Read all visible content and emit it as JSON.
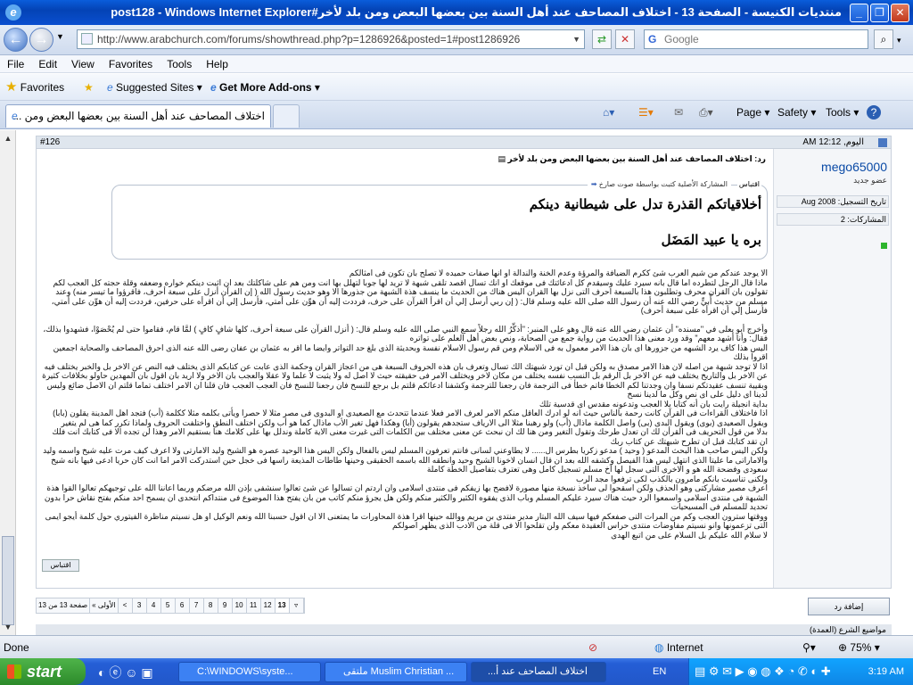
{
  "window": {
    "title": "منتديات الكنيسة - الصفحة 13 - اختلاف المصاحف عند أهل السنة بين بعضها البعض ومن بلد لأخر#post128 - Windows Internet Explorer",
    "minimize": "_",
    "maximize": "❐",
    "close": "✕"
  },
  "address": {
    "url": "http://www.arabchurch.com/forums/showthread.php?p=1286926&posted=1#post1286926",
    "search_placeholder": "Google"
  },
  "menu": [
    "File",
    "Edit",
    "View",
    "Favorites",
    "Tools",
    "Help"
  ],
  "favorites_bar": {
    "favorites": "Favorites",
    "suggested": "Suggested Sites ▾",
    "addons": "Get More Add-ons ▾"
  },
  "tabs": {
    "active": "اختلاف المصاحف عند أهل السنة بين بعضها البعض ومن ..."
  },
  "command_bar": {
    "page": "Page ▾",
    "safety": "Safety ▾",
    "tools": "Tools ▾",
    "help": "?"
  },
  "post": {
    "number": "#126",
    "date": "اليوم, 12:12 AM",
    "reply_title": "رد: اختلاف المصاحف عند أهل السنة بين بعضها البعض ومن بلد لأخر",
    "quote_header": "المشاركة الأصلية كتبت بواسطة صوت صارخ",
    "quote_label": "اقتباس",
    "quote_line1": "أخلاقياتكم القذرة تدل على شيطانية دينكم",
    "quote_line2": "بره يا عبيد المَضَل",
    "paragraphs": [
      "الا يوجد عندكم من شيم العرب شئ ككرم الضيافة والمرؤة وعدم الخنة والندالة او انها صفات حميده لا تصلح بان تكون فى امثالكم",
      "ماذا قال الرجل لتطرده اما قال بانه سيرد عليك وسيقدم كل ادعائتك فى موقعك او انك تسال اقصد تلقى شبهة لا تريد لها جوبا لتهلل بها انت ومن هم على شاكلتك بعد ان اثبت دينكم خواره وضعفه وقلة حجته كل العجب لكم تقولون بان القران محرف وتطلبون هذا بالسبعة احرف التى نزل بها القران اليس هناك من الحديث ما ينسف هذة الشبهة من جذورها الا وهو حديث رسول الله ( إن القرآن أنزل على سبعة أحرف، فاقرؤوا ما تيسر منه) وعند مسلم من حديث أُبيٍّ رضي الله عنه أن رسول الله صلى الله عليه وسلم قال: ( إن ربي أرسل إلي أن اقرأ القرآن على حرف، فرددت إليه أن هوِّن على أمتي، فأرسل إلي أن اقرأه على حرفين، فرددت إليه أن هوِّن على أمتي، فأرسل إلي أن اقرأه على سبعة أحرف)",
      "وأخرج أبو يعلى في \"مسنده\" أن عثمان رضي الله عنه قال وهو على المنبر: \"أذكِّرُ الله رجلاً سمع النبي صلى الله عليه وسلم قال: ( أنزل القرآن على سبعة أحرف، كلها شافٍ كافٍ ) لمَّا قام، فقاموا حتى لم يُحْصَوْا، فشهدوا بذلك، فقال: وأنا أشهد معهم\" وقد ورد معنى هذا الحديث من رواية جمع من الصحابة، ونص بعض أهل العلم على تواتره",
      "اليس هذا كاف يرد الشبهه من جزورها اى بان هذا الامر معمول به فى الاسلام ومن قم رسول الاسلام نفسة وبحديثة الذى بلغ حد التواتر وايضا ما اقر به عثمان بن عفان رضى الله عنه الذى احرق المصاحف والصحابة اجمعين اقروا بذلك",
      "اذا لا توجد شبهة من اصله لان هذا الامر مصدق به ولكن قبل ان تورد شبهتك الك تسال وتعرف بان هذه الحروف السبعة هى من اعجاز القران وحكمة الذى عابت عن كتابكم الذى يختلف فيه النص عن الاخر بل والخبر يختلف فيه عن الاخر بل والتاريخ يختلف فيه عن الاخر بل الرقم بل النسب نفسه يختلف من مكان لاخر ويختلف الامر فى حقيقته حيث لا اصل له ولا يثبت لا علما ولا عقلا والعجب بان الاخر ولا اريد بان اقول بان المهدين حاولو بخلافات كثيرة وبقيية تنسف عقيدتكم نسفا وان وجدتنا لكم الخطا فاتم خطأ فى الترجمة فان رجعنا للترجمة وكشفنا ادعائكم قلتم بل برجع للنسخ فان رجعنا للنسخ فان العجب العجب فان قلنا ان الامر اختلف تماما قلتم ان الاصل ضائع وليس لدينا اى دليل على اى نص وكل ما لدينا نسخ",
      "بداية انجيلة رايت بان أنه كتابا بلا العجب وتدعونه مقدس اى قدسية تلك",
      "اذا فاختلاف القراءات فى القرآن كانت رحمة بالناس حيث انه لو ادرك العاقل منكم الامر لعرف الامر فعلا عندما تتحدث مع الصعيدى او البدوى فى مصر مثلا لا حصرا ويأتى بكلمه مثلا ككلمة (أب) فتجد اهل المدينة يقلون (بابا) ويقول الصعيدى (بوى) ويقول البدى (بى) واصل الكلمة ماذال (أب) ولو رهبنا مثلا الى الارياف ستجدهم يقولون (أبا) وهكذا فهل تغير الأب ماذال كما هو أب ولكن اختلف النطق واختلفت الحروف ولماذا تكرر كما هى لم يتغير",
      "بدلا من قول التحريف فى القرأن لك ان تعدل طرحك وتقول التغير ومن هنا لك ان نبحث عن معنى مختلف بين الكلمات التى غيرت معنى الاية كاملة وندلل بها على كلامك هنا بستقيم الامر وهذا لن تجده الا فى كتابك انت فلك ان تقد كتابك قبل ان تطرح شبهتك عن كتاب ربك",
      "ولكن اليس صاحب هذا البحث المدعو ( وحيد ) مدعو زكريا بطرس ال...... لا يطاوعني لسانى فانتم تعرفون المسلم ليس بالفعال ولكن اليس هذا الوحيد عصره هو الشيخ وليد الامارتى ولا اعرف كيف مرت عليه شيخ واسمه وليد والاماراتى ما عليتا الذى انتهل ليس هذا الفيصل وكشفه الله بعد ان قال انسان لاخونا الشيخ وحيد وانطقه الله باسمه الحقيقى وحينها طاطات المذيعة راسها فى خجل حين استدركت الامر اما انت كان حريا ادعى فيها بانه شيخ سعودى وفضحة الله هو و الاخرى التى سجل لها آخ مسلم تسجيل كامل وهى تعترف بتفاصيل الخطة كاملة",
      "ولكنى تناسيت بانكم مامرون بالكذب لكى ترفعوا مجد الرب",
      "اعرف مصير مشاركتى وهو الحذف ولكن اسقحوا لى ساخذ نسخة منها مصورة لافضح بها زيفكم فى منتدى اسلامى وان اردتم ان تسالوا عن شئ تعالوا سنشفى بإذن الله مرضكم وربما اعاننا الله على توجيهكم تعالوا القوا هذة الشبهة فى منتدى اسلامى واسمعوا الرد حيث هناك سيرد عليكم المسلم وباب الذى يفقوه الكثير والكثير منكم ولكن هل يجرؤ منكم كاتب من بان يفتح هذا الموضوع فى منتداكم انتحدى ان يسمح احد منكم بفتح نقاش حرا بدون تحديد للمسلم فى المسيحيات",
      "ووقتها سترون العجب وكم من المرات التى صفعكم فيها سيف الله البتار مدير منتدى بن مريم ووالله حينها اقرا هذة المحاورات ما يمتعنى الا ان اقول حسبنا الله ونعم الوكيل او هل نسيتم مناظرة الفيتوري حول كلمة أيجو ايمى التى تزعمونها وانو نسيتم مفاوضات منتدى حراس العقيدة معكم ولن تقلحوا الا فى قلة من الادب الذى يظهر اصولكم",
      "لا سلام الله عليكم بل السلام على من اتبع الهدى"
    ],
    "quote_button": "اقتباس"
  },
  "user": {
    "name": "mego65000",
    "title": "عضو جديد",
    "join_date": "تاريخ التسجيل: Aug 2008",
    "posts": "المشاركات: 2"
  },
  "pagination": {
    "label": "صفحة 13 من 13",
    "first": "« الأولى",
    "prev": "<",
    "pages": [
      "3",
      "4",
      "5",
      "6",
      "7",
      "8",
      "9",
      "10",
      "11",
      "12",
      "13"
    ],
    "current": "13"
  },
  "reply_button": "إضافة رد",
  "below_label": "مواضيع الشرع (العمدة)",
  "status": {
    "left": "Done",
    "zone": "Internet",
    "zoom": "75%"
  },
  "taskbar": {
    "start": "start",
    "tasks": [
      "C:\\WINDOWS\\syste...",
      "ملتقى Muslim Christian ...",
      "اختلاف المصاحف عند أ..."
    ],
    "lang": "EN",
    "clock": "3:19 AM"
  },
  "colors": {
    "titlebar": "#0443b5",
    "link": "#0a4aa6",
    "start": "#2c8a2a",
    "taskbar": "#245ed6"
  }
}
